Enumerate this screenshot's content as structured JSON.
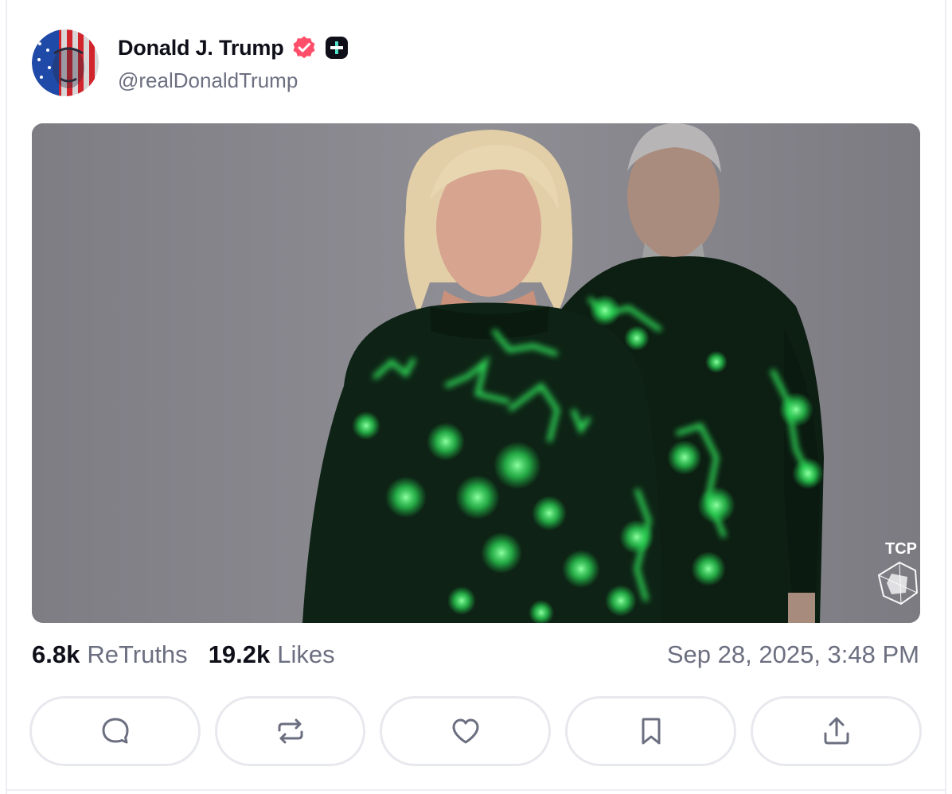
{
  "post": {
    "author": {
      "display_name": "Donald J. Trump",
      "handle": "@realDonaldTrump",
      "verified": true,
      "avatar_icon": "flag-portrait-avatar"
    },
    "media": {
      "type": "image",
      "watermark": "TCP"
    },
    "stats": {
      "retruths_count": "6.8k",
      "retruths_label": "ReTruths",
      "likes_count": "19.2k",
      "likes_label": "Likes"
    },
    "timestamp": "Sep 28, 2025, 3:48 PM",
    "actions": [
      {
        "name": "reply",
        "icon": "comment-icon"
      },
      {
        "name": "retruth",
        "icon": "repost-icon"
      },
      {
        "name": "like",
        "icon": "heart-icon"
      },
      {
        "name": "bookmark",
        "icon": "bookmark-icon"
      },
      {
        "name": "share",
        "icon": "share-icon"
      }
    ]
  },
  "colors": {
    "text_primary": "#0f0f19",
    "text_secondary": "#6b6f80",
    "verified_badge": "#ff4f6b",
    "border": "#e8e9ee",
    "glow_green": "#3dff6a"
  }
}
